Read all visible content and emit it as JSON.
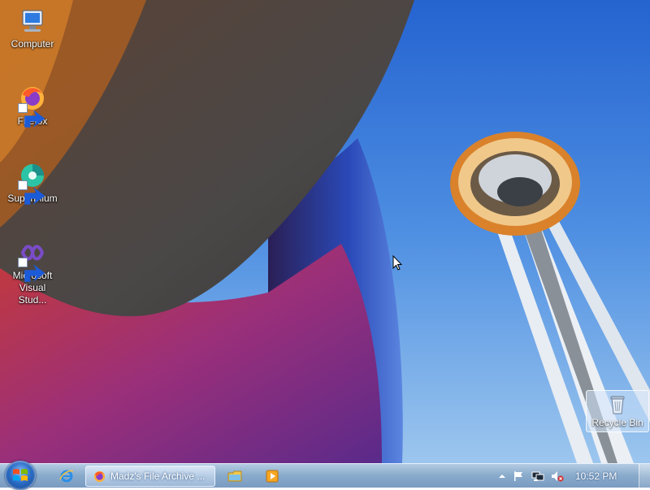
{
  "desktop": {
    "icons": [
      {
        "label": "Computer",
        "icon": "computer-icon"
      },
      {
        "label": "Firefox",
        "icon": "firefox-icon"
      },
      {
        "label": "Supermium",
        "icon": "supermium-icon"
      },
      {
        "label": "Microsoft Visual Stud...",
        "icon": "visual-studio-icon"
      }
    ],
    "recycle_bin": {
      "label": "Recycle Bin",
      "icon": "recycle-bin-icon"
    }
  },
  "taskbar": {
    "start": {
      "icon": "windows-logo-icon"
    },
    "pinned": [
      {
        "icon": "internet-explorer-icon"
      },
      {
        "icon": "file-explorer-icon"
      },
      {
        "icon": "media-player-icon"
      }
    ],
    "window_button": {
      "label": "Madz's File Archive ...",
      "icon": "firefox-icon"
    },
    "tray": {
      "icons": [
        "show-hidden-icons-icon",
        "action-center-flag-icon",
        "network-icon",
        "volume-muted-icon"
      ],
      "clock": "10:52 PM"
    }
  },
  "colors": {
    "sky": "#4d8be0",
    "taskbar": "#8fb0d4",
    "accent_orange": "#d9822b"
  }
}
